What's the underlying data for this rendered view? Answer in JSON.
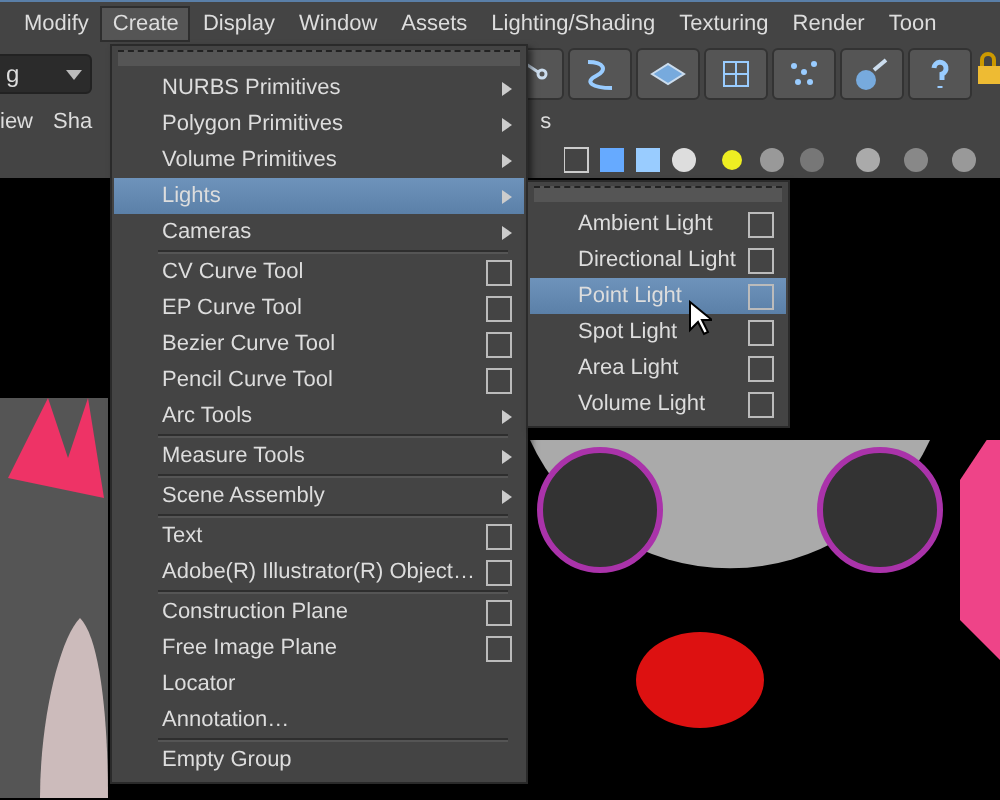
{
  "menubar": [
    {
      "label": "Modify",
      "selected": false
    },
    {
      "label": "Create",
      "selected": true
    },
    {
      "label": "Display",
      "selected": false
    },
    {
      "label": "Window",
      "selected": false
    },
    {
      "label": "Assets",
      "selected": false
    },
    {
      "label": "Lighting/Shading",
      "selected": false
    },
    {
      "label": "Texturing",
      "selected": false
    },
    {
      "label": "Render",
      "selected": false
    },
    {
      "label": "Toon",
      "selected": false
    }
  ],
  "mode_dropdown": {
    "value": "g"
  },
  "panel_menu": [
    "iew",
    "Sha",
    "s"
  ],
  "create_menu": [
    {
      "kind": "submenu",
      "label": "NURBS Primitives",
      "selected": false
    },
    {
      "kind": "submenu",
      "label": "Polygon Primitives",
      "selected": false
    },
    {
      "kind": "submenu",
      "label": "Volume Primitives",
      "selected": false
    },
    {
      "kind": "submenu",
      "label": "Lights",
      "selected": true
    },
    {
      "kind": "submenu",
      "label": "Cameras",
      "selected": false
    },
    {
      "kind": "separator"
    },
    {
      "kind": "option",
      "label": "CV Curve Tool",
      "selected": false
    },
    {
      "kind": "option",
      "label": "EP Curve Tool",
      "selected": false
    },
    {
      "kind": "option",
      "label": "Bezier Curve Tool",
      "selected": false
    },
    {
      "kind": "option",
      "label": "Pencil Curve Tool",
      "selected": false
    },
    {
      "kind": "submenu",
      "label": "Arc Tools",
      "selected": false
    },
    {
      "kind": "separator"
    },
    {
      "kind": "submenu",
      "label": "Measure Tools",
      "selected": false
    },
    {
      "kind": "separator"
    },
    {
      "kind": "submenu",
      "label": "Scene Assembly",
      "selected": false
    },
    {
      "kind": "separator"
    },
    {
      "kind": "option",
      "label": "Text",
      "selected": false
    },
    {
      "kind": "option",
      "label": "Adobe(R) Illustrator(R) Object…",
      "selected": false
    },
    {
      "kind": "separator"
    },
    {
      "kind": "option",
      "label": "Construction Plane",
      "selected": false
    },
    {
      "kind": "option",
      "label": "Free Image Plane",
      "selected": false
    },
    {
      "kind": "plain",
      "label": "Locator",
      "selected": false
    },
    {
      "kind": "plain",
      "label": "Annotation…",
      "selected": false
    },
    {
      "kind": "separator"
    },
    {
      "kind": "plain",
      "label": "Empty Group",
      "selected": false
    }
  ],
  "lights_menu": [
    {
      "kind": "option",
      "label": "Ambient Light",
      "selected": false
    },
    {
      "kind": "option",
      "label": "Directional Light",
      "selected": false
    },
    {
      "kind": "option",
      "label": "Point Light",
      "selected": true
    },
    {
      "kind": "option",
      "label": "Spot Light",
      "selected": false
    },
    {
      "kind": "option",
      "label": "Area Light",
      "selected": false
    },
    {
      "kind": "option",
      "label": "Volume Light",
      "selected": false
    }
  ]
}
